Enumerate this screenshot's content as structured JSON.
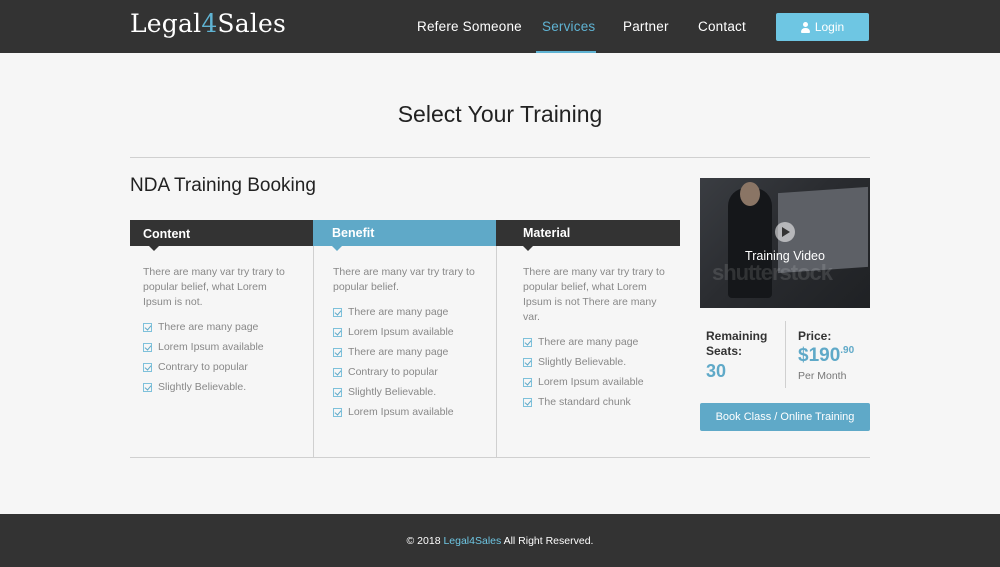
{
  "header": {
    "logo_prefix": "Legal",
    "logo_number": "4",
    "logo_suffix": "Sales",
    "nav": [
      {
        "label": "Refere Someone"
      },
      {
        "label": "Services",
        "active": true
      },
      {
        "label": "Partner"
      },
      {
        "label": "Contact"
      }
    ],
    "login_label": "Login"
  },
  "main": {
    "title": "Select Your Training",
    "booking_title": "NDA Training Booking",
    "columns": [
      {
        "heading": "Content",
        "description": "There are many var try trary to popular belief, what Lorem Ipsum is not.",
        "items": [
          "There are many page",
          "Lorem Ipsum available",
          "Contrary to popular",
          "Slightly Believable."
        ]
      },
      {
        "heading": "Benefit",
        "description": "There are many var try trary to popular belief.",
        "items": [
          "There are many page",
          "Lorem Ipsum available",
          "There are many page",
          "Contrary to popular",
          "Slightly Believable.",
          "Lorem Ipsum available"
        ]
      },
      {
        "heading": "Material",
        "description": "There are many var try trary to popular belief, what Lorem Ipsum is not There are many var.",
        "items": [
          "There are many page",
          "Slightly Believable.",
          "Lorem Ipsum available",
          "The standard chunk"
        ]
      }
    ],
    "video": {
      "label": "Training Video",
      "watermark": "shutterstock"
    },
    "seats": {
      "label": "Remaining Seats:",
      "value": "30"
    },
    "price": {
      "label": "Price:",
      "currency_amount": "$190",
      "cents": ".90",
      "period": "Per Month"
    },
    "book_button": "Book Class / Online Training"
  },
  "footer": {
    "copyright": "© 2018 ",
    "brand": "Legal4Sales",
    "rights": " All Right Reserved."
  },
  "colors": {
    "accent": "#5fa9c8",
    "header_bg": "#333333",
    "login_bg": "#6ec6e3"
  }
}
